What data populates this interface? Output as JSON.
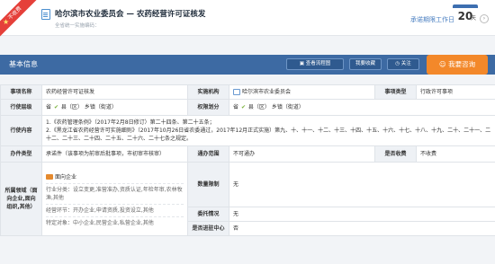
{
  "header": {
    "ribbon_label": "不收费",
    "title": "哈尔滨市农业委员会 — 农药经营许可证核发",
    "subtitle": "全省统一实施编码：",
    "deadline_label": "承诺期限工作日",
    "deadline_value": "20",
    "deadline_unit": "天",
    "next_icon": "chevron-right-icon"
  },
  "toolbar": {
    "section_title": "基本信息",
    "view_flowchart": "查看流程图",
    "favorite": "我要收藏",
    "follow": "关注",
    "consult": "我要咨询"
  },
  "rows": {
    "item_type_label": "事项名称",
    "item_type_value": "农药经营许可证核发",
    "agency_label": "实施机构",
    "agency_value": "哈尔滨市农业委员会",
    "category_label": "事项类型",
    "category_value": "行政许可事项",
    "level_label": "行使层级",
    "level_value": "省   ✔ 县（区）乡镇（街道）",
    "level_province": "省",
    "level_county": "县（区）",
    "level_town": "乡镇（街道）",
    "power_label": "权限划分",
    "power_province": "省",
    "power_county": "县（区）",
    "power_town": "乡镇（街道）",
    "content_label": "行使内容",
    "content_line1": "1.《农药管理条例》（2017年2月8日修订）第二十四条、第二十五条；",
    "content_line2": "2.《黑龙江省农药经营许可实施细则》（2017年10月26日省农委通过，2017年12月正式实施）第九、十、十一、十二、十三、十四、十五、十六、十七、十八、十九、二十、二十一、二十二、二十三、二十四、二十五、二十六、二十七条之规定。",
    "process_label": "办件类型",
    "process_value": "承诺件（该事项为前审后批事项，市初审市核审）",
    "cross_label": "通办范围",
    "cross_value": "不可通办",
    "fee_label": "是否收费",
    "fee_value": "不收费",
    "scope_label": "所属领域（面向企业,面向组织,其他）",
    "scope_enterprise": "面向企业",
    "scope_industry": "行业分类：设立变更,准营准办,资质认证,年检年审,农林牧渔,其他",
    "scope_operation": "经营环节：开办企业,申请资质,投资设立,其他",
    "scope_special": "特定对象：中小企业,民营企业,私营企业,其他",
    "quantity_label": "数量限制",
    "quantity_value": "无",
    "delegate_label": "委托情况",
    "delegate_value": "无",
    "center_label": "是否进驻中心",
    "center_value": "否"
  }
}
